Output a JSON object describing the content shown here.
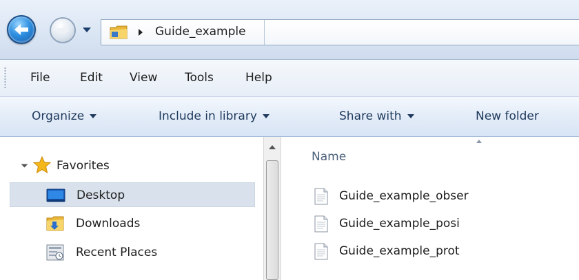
{
  "address_bar": {
    "breadcrumb": "Guide_example"
  },
  "menu": {
    "items": [
      "File",
      "Edit",
      "View",
      "Tools",
      "Help"
    ]
  },
  "command_bar": {
    "organize": "Organize",
    "include_in_library": "Include in library",
    "share_with": "Share with",
    "new_folder": "New folder"
  },
  "nav_pane": {
    "favorites": "Favorites",
    "items": [
      "Desktop",
      "Downloads",
      "Recent Places"
    ],
    "selected": "Desktop"
  },
  "file_list": {
    "column_name": "Name",
    "files": [
      "Guide_example_obser",
      "Guide_example_posi",
      "Guide_example_prot"
    ]
  },
  "icons": {
    "back": "back-arrow-icon",
    "forward": "forward-arrow-icon",
    "folder": "folder-icon",
    "favorites": "star-icon",
    "desktop": "desktop-icon",
    "downloads": "downloads-folder-icon",
    "recent": "recent-places-icon",
    "file": "text-file-icon"
  },
  "colors": {
    "accent": "#2f8fe0",
    "selection": "#d9e2ec",
    "favorites_star": "#f5b81c"
  }
}
